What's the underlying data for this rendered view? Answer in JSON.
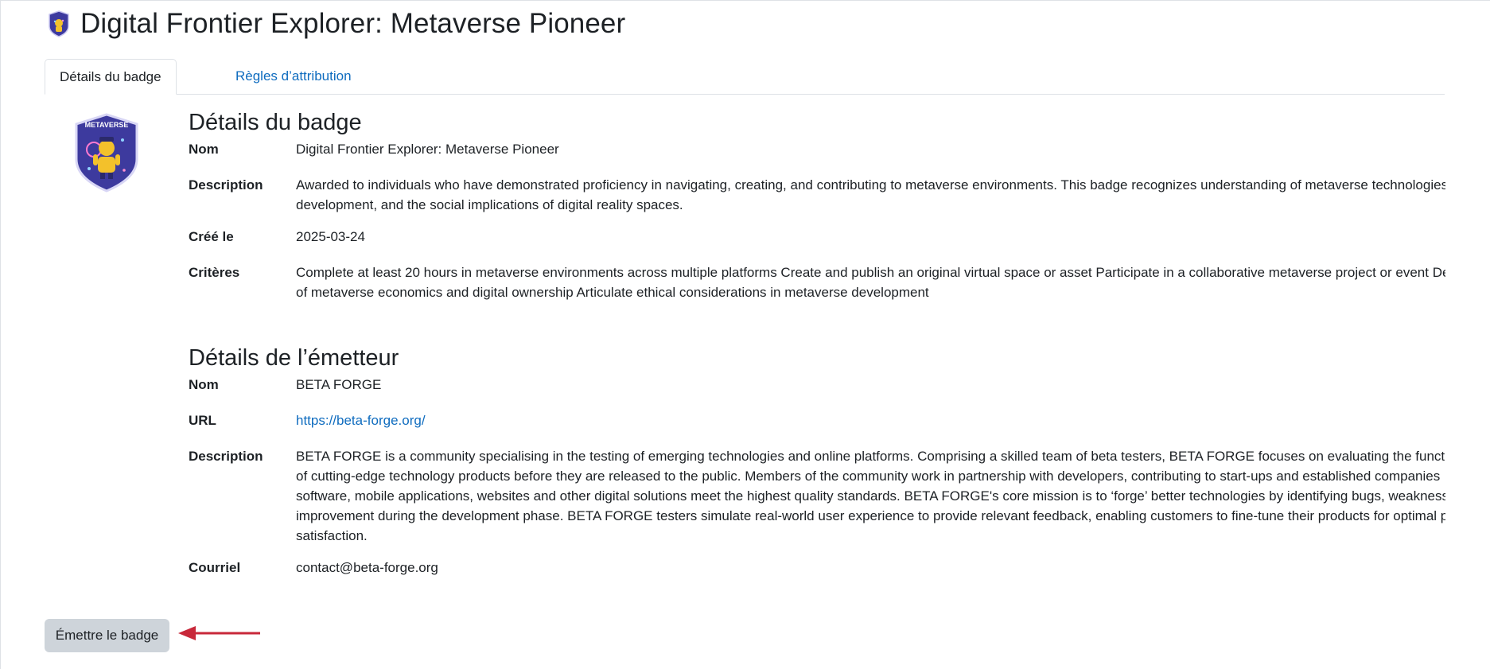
{
  "page": {
    "title": "Digital Frontier Explorer: Metaverse Pioneer"
  },
  "tabs": [
    {
      "label": "Détails du badge",
      "active": true
    },
    {
      "label": "Règles d’attribution",
      "active": false
    }
  ],
  "badge_image": {
    "text": "METAVERSE",
    "colors": {
      "shield": "#3d3a9e",
      "border": "#c9c6f0",
      "character": "#f3c12b"
    }
  },
  "badge_details": {
    "heading": "Détails du badge",
    "name_label": "Nom",
    "name": "Digital Frontier Explorer: Metaverse Pioneer",
    "description_label": "Description",
    "description_lines": [
      "Awarded to individuals who have demonstrated proficiency in navigating, creating, and contributing to metaverse environments. This badge recognizes understanding of metaverse technologies,",
      "development, and the social implications of digital reality spaces."
    ],
    "created_label": "Créé le",
    "created": "2025-03-24",
    "criteria_label": "Critères",
    "criteria_lines": [
      "Complete at least 20 hours in metaverse environments across multiple platforms Create and publish an original virtual space or asset Participate in a collaborative metaverse project or event Dem",
      "of metaverse economics and digital ownership Articulate ethical considerations in metaverse development"
    ]
  },
  "issuer_details": {
    "heading": "Détails de l’émetteur",
    "name_label": "Nom",
    "name": "BETA FORGE",
    "url_label": "URL",
    "url": "https://beta-forge.org/",
    "description_label": "Description",
    "description_lines": [
      "BETA FORGE is a community specialising in the testing of emerging technologies and online platforms. Comprising a skilled team of beta testers, BETA FORGE focuses on evaluating the functionali",
      "of cutting-edge technology products before they are released to the public. Members of the community work in partnership with developers, contributing to start-ups and established companies",
      "software, mobile applications, websites and other digital solutions meet the highest quality standards. BETA FORGE's core mission is to ‘forge’ better technologies by identifying bugs, weaknesses",
      "improvement during the development phase. BETA FORGE testers simulate real-world user experience to provide relevant feedback, enabling customers to fine-tune their products for optimal per",
      "satisfaction."
    ],
    "email_label": "Courriel",
    "email": "contact@beta-forge.org"
  },
  "actions": {
    "issue_badge_label": "Émettre le badge"
  },
  "colors": {
    "link": "#0f6cbf",
    "button_bg": "#ced4da",
    "arrow": "#c8283a"
  }
}
